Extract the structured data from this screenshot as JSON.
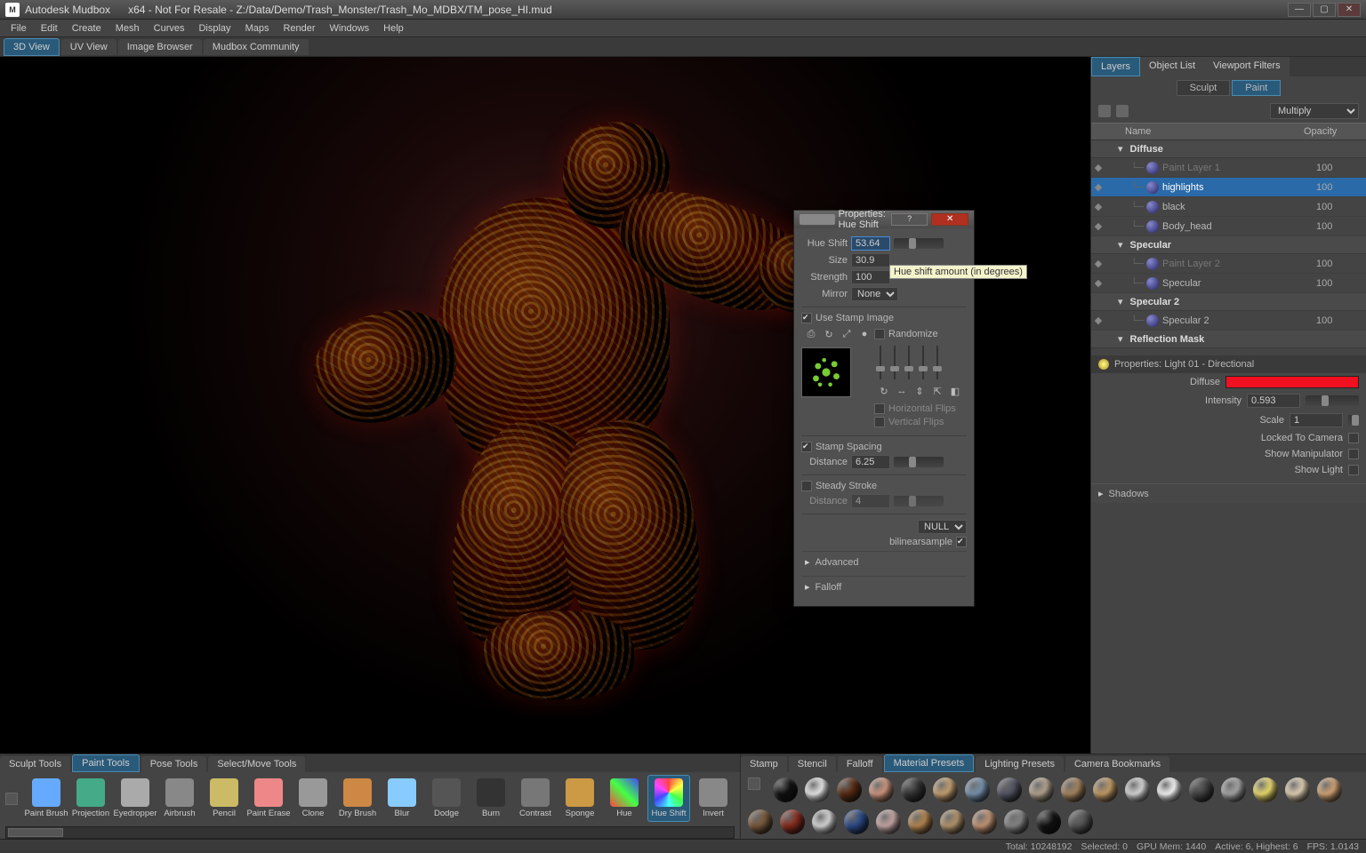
{
  "titlebar": {
    "app": "Autodesk Mudbox",
    "doc": "x64 - Not For Resale - Z:/Data/Demo/Trash_Monster/Trash_Mo_MDBX/TM_pose_HI.mud"
  },
  "menu": [
    "File",
    "Edit",
    "Create",
    "Mesh",
    "Curves",
    "Display",
    "Maps",
    "Render",
    "Windows",
    "Help"
  ],
  "viewtabs": [
    "3D View",
    "UV View",
    "Image Browser",
    "Mudbox Community"
  ],
  "rightpanel": {
    "tabs": [
      "Layers",
      "Object List",
      "Viewport Filters"
    ],
    "modes": [
      "Sculpt",
      "Paint"
    ],
    "blend_mode": "Multiply",
    "columns": {
      "name": "Name",
      "opacity": "Opacity"
    },
    "groups": [
      {
        "title": "Diffuse",
        "layers": [
          {
            "name": "Paint Layer 1",
            "opacity": "100",
            "dim": true
          },
          {
            "name": "highlights",
            "opacity": "100",
            "selected": true
          },
          {
            "name": "black",
            "opacity": "100"
          },
          {
            "name": "Body_head",
            "opacity": "100"
          }
        ]
      },
      {
        "title": "Specular",
        "layers": [
          {
            "name": "Paint Layer 2",
            "opacity": "100",
            "dim": true
          },
          {
            "name": "Specular",
            "opacity": "100"
          }
        ]
      },
      {
        "title": "Specular 2",
        "layers": [
          {
            "name": "Specular 2",
            "opacity": "100"
          }
        ]
      },
      {
        "title": "Reflection Mask",
        "layers": []
      }
    ],
    "light": {
      "title": "Properties: Light 01 - Directional",
      "diffuse_label": "Diffuse",
      "intensity_label": "Intensity",
      "intensity": "0.593",
      "scale_label": "Scale",
      "scale": "1",
      "locked": "Locked To Camera",
      "manip": "Show Manipulator",
      "showlight": "Show Light",
      "shadows": "Shadows"
    }
  },
  "dialog": {
    "title": "Properties: Hue Shift",
    "rows": {
      "hue": "Hue Shift",
      "hue_v": "53.64",
      "size": "Size",
      "size_v": "30.9",
      "strength": "Strength",
      "strength_v": "100",
      "mirror": "Mirror",
      "mirror_v": "None"
    },
    "tooltip": "Hue shift amount (in degrees)",
    "use_stamp": "Use Stamp Image",
    "randomize": "Randomize",
    "hflip": "Horizontal Flips",
    "vflip": "Vertical Flips",
    "stamp_spacing": "Stamp Spacing",
    "distance": "Distance",
    "distance_v": "6.25",
    "steady": "Steady Stroke",
    "steady_dist": "Distance",
    "steady_dist_v": "4",
    "null": "NULL",
    "bilinear": "bilinearsample",
    "advanced": "Advanced",
    "falloff": "Falloff"
  },
  "shelfL": {
    "tabs": [
      "Sculpt Tools",
      "Paint Tools",
      "Pose Tools",
      "Select/Move Tools"
    ],
    "tools": [
      "Paint Brush",
      "Projection",
      "Eyedropper",
      "Airbrush",
      "Pencil",
      "Paint Erase",
      "Clone",
      "Dry Brush",
      "Blur",
      "Dodge",
      "Burn",
      "Contrast",
      "Sponge",
      "Hue",
      "Hue Shift",
      "Invert"
    ]
  },
  "shelfR": {
    "tabs": [
      "Stamp",
      "Stencil",
      "Falloff",
      "Material Presets",
      "Lighting Presets",
      "Camera Bookmarks"
    ],
    "mats": [
      "#111",
      "#eee",
      "#5a2a10",
      "#d49a82",
      "#333",
      "#caa574",
      "#7a96b2",
      "#556",
      "#b8a892",
      "#a98860",
      "#c8a068",
      "#ddd",
      "#fff",
      "#444",
      "#aaa",
      "#f2e270",
      "#e8d6b8",
      "#d8a878",
      "#7a5a3a",
      "#8a2a1a",
      "#ddd",
      "#2a4a8a",
      "#caa",
      "#b88850",
      "#b8986e",
      "#c89878",
      "#888",
      "#111",
      "#555"
    ]
  },
  "status": {
    "total": "Total: 10248192",
    "selected": "Selected: 0",
    "gpu": "GPU Mem: 1440",
    "active": "Active: 6, Highest: 6",
    "fps": "FPS: 1.0143"
  }
}
